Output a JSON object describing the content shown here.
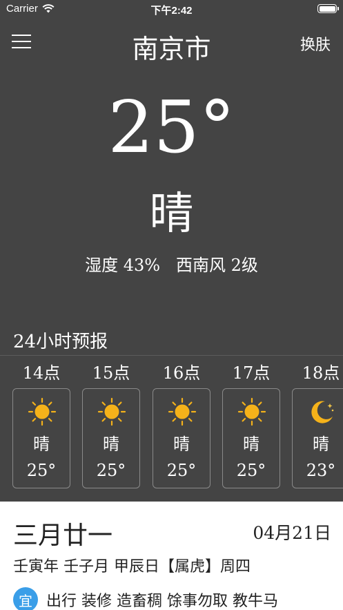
{
  "status_bar": {
    "carrier": "Carrier",
    "time": "下午2:42"
  },
  "nav": {
    "city": "南京市",
    "skin_label": "换肤"
  },
  "current": {
    "temperature": "25°",
    "condition": "晴",
    "humidity_wind": "湿度 43%   西南风 2级"
  },
  "forecast": {
    "title": "24小时预报",
    "hours": [
      {
        "time": "14点",
        "icon": "sun-icon",
        "condition": "晴",
        "temp": "25°"
      },
      {
        "time": "15点",
        "icon": "sun-icon",
        "condition": "晴",
        "temp": "25°"
      },
      {
        "time": "16点",
        "icon": "sun-icon",
        "condition": "晴",
        "temp": "25°"
      },
      {
        "time": "17点",
        "icon": "sun-icon",
        "condition": "晴",
        "temp": "25°"
      },
      {
        "time": "18点",
        "icon": "moon-icon",
        "condition": "晴",
        "temp": "23°"
      }
    ]
  },
  "calendar": {
    "lunar_date": "三月廿一",
    "solar_date": "04月21日",
    "ganzhi": "壬寅年 壬子月 甲辰日【属虎】周四",
    "yi_label": "宜",
    "yi_items": "出行 装修 造畜稠 馀事勿取 教牛马"
  },
  "colors": {
    "background": "#444444",
    "calendar_bg": "#ffffff",
    "yi_badge": "#3a9ee8",
    "sun": "#f5b21a"
  }
}
